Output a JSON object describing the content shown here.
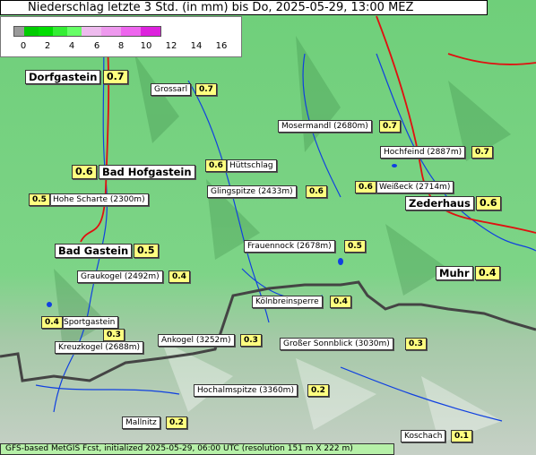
{
  "title": "Niederschlag letzte 3 Std. (in mm) bis Do, 2025-05-29, 13:00 MEZ",
  "legend": {
    "ticks": [
      "0",
      "2",
      "4",
      "6",
      "8",
      "10",
      "12",
      "14",
      "16"
    ],
    "colors": [
      "#9a9a9a",
      "#00cc00",
      "#00dd00",
      "#33ee33",
      "#66ff66",
      "#eebbee",
      "#ee99ee",
      "#ee66ee",
      "#dd22dd"
    ]
  },
  "places": [
    {
      "name": "Dorfgastein",
      "value": "0.7",
      "big": true
    },
    {
      "name": "Grossarl",
      "value": "0.7",
      "big": false
    },
    {
      "name": "Mosermandl (2680m)",
      "value": "0.7",
      "big": false
    },
    {
      "name": "Hochfeind (2887m)",
      "value": "0.7",
      "big": false
    },
    {
      "name": "Bad Hofgastein",
      "value": "0.6",
      "big": true
    },
    {
      "name": "Hüttschlag",
      "value": "0.6",
      "big": false
    },
    {
      "name": "Hohe Scharte (2300m)",
      "value": "0.5",
      "big": false
    },
    {
      "name": "Glingspitze (2433m)",
      "value": "0.6",
      "big": false
    },
    {
      "name": "Weißeck (2714m)",
      "value": "0.6",
      "big": false
    },
    {
      "name": "Zederhaus",
      "value": "0.6",
      "big": true
    },
    {
      "name": "Frauennock (2678m)",
      "value": "0.5",
      "big": false
    },
    {
      "name": "Bad Gastein",
      "value": "0.5",
      "big": true
    },
    {
      "name": "Graukogel (2492m)",
      "value": "0.4",
      "big": false
    },
    {
      "name": "Muhr",
      "value": "0.4",
      "big": true
    },
    {
      "name": "Kölnbreinsperre",
      "value": "0.4",
      "big": false
    },
    {
      "name": "Sportgastein",
      "value": "0.4",
      "big": false
    },
    {
      "name": "Kreuzkogel (2688m)",
      "value": "0.3",
      "big": false
    },
    {
      "name": "Ankogel (3252m)",
      "value": "0.3",
      "big": false
    },
    {
      "name": "Großer Sonnblick (3030m)",
      "value": "0.3",
      "big": false
    },
    {
      "name": "Hochalmspitze (3360m)",
      "value": "0.2",
      "big": false
    },
    {
      "name": "Mallnitz",
      "value": "0.2",
      "big": false
    },
    {
      "name": "Koschach",
      "value": "0.1",
      "big": false
    }
  ],
  "footer": "GFS-based MetGIS Fcst, initialized 2025-05-29, 06:00 UTC  (resolution 151 m X 222 m)"
}
